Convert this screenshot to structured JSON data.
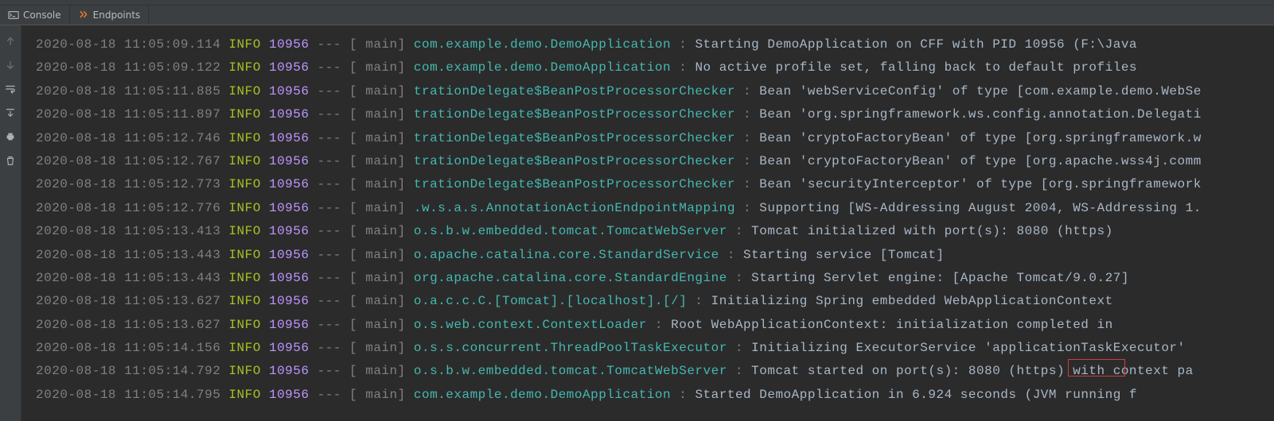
{
  "tabs": {
    "console": "Console",
    "endpoints": "Endpoints"
  },
  "log_fixed": {
    "thread_prefix": "",
    "thread": "main",
    "dashes": "---",
    "separator": ":"
  },
  "logs": [
    {
      "ts": "2020-08-18 11:05:09.114",
      "level": "INFO",
      "pid": "10956",
      "cls": "com.example.demo.DemoApplication",
      "msg": "Starting DemoApplication on CFF with PID 10956 (F:\\Java"
    },
    {
      "ts": "2020-08-18 11:05:09.122",
      "level": "INFO",
      "pid": "10956",
      "cls": "com.example.demo.DemoApplication",
      "msg": "No active profile set, falling back to default profiles"
    },
    {
      "ts": "2020-08-18 11:05:11.885",
      "level": "INFO",
      "pid": "10956",
      "cls": "trationDelegate$BeanPostProcessorChecker",
      "msg": "Bean 'webServiceConfig' of type [com.example.demo.WebSe"
    },
    {
      "ts": "2020-08-18 11:05:11.897",
      "level": "INFO",
      "pid": "10956",
      "cls": "trationDelegate$BeanPostProcessorChecker",
      "msg": "Bean 'org.springframework.ws.config.annotation.Delegati"
    },
    {
      "ts": "2020-08-18 11:05:12.746",
      "level": "INFO",
      "pid": "10956",
      "cls": "trationDelegate$BeanPostProcessorChecker",
      "msg": "Bean 'cryptoFactoryBean' of type [org.springframework.w"
    },
    {
      "ts": "2020-08-18 11:05:12.767",
      "level": "INFO",
      "pid": "10956",
      "cls": "trationDelegate$BeanPostProcessorChecker",
      "msg": "Bean 'cryptoFactoryBean' of type [org.apache.wss4j.comm"
    },
    {
      "ts": "2020-08-18 11:05:12.773",
      "level": "INFO",
      "pid": "10956",
      "cls": "trationDelegate$BeanPostProcessorChecker",
      "msg": "Bean 'securityInterceptor' of type [org.springframework"
    },
    {
      "ts": "2020-08-18 11:05:12.776",
      "level": "INFO",
      "pid": "10956",
      "cls": ".w.s.a.s.AnnotationActionEndpointMapping",
      "msg": "Supporting [WS-Addressing August 2004, WS-Addressing 1."
    },
    {
      "ts": "2020-08-18 11:05:13.413",
      "level": "INFO",
      "pid": "10956",
      "cls": "o.s.b.w.embedded.tomcat.TomcatWebServer",
      "msg": "Tomcat initialized with port(s): 8080 (https)"
    },
    {
      "ts": "2020-08-18 11:05:13.443",
      "level": "INFO",
      "pid": "10956",
      "cls": "o.apache.catalina.core.StandardService",
      "msg": "Starting service [Tomcat]"
    },
    {
      "ts": "2020-08-18 11:05:13.443",
      "level": "INFO",
      "pid": "10956",
      "cls": "org.apache.catalina.core.StandardEngine",
      "msg": "Starting Servlet engine: [Apache Tomcat/9.0.27]"
    },
    {
      "ts": "2020-08-18 11:05:13.627",
      "level": "INFO",
      "pid": "10956",
      "cls": "o.a.c.c.C.[Tomcat].[localhost].[/]",
      "msg": "Initializing Spring embedded WebApplicationContext"
    },
    {
      "ts": "2020-08-18 11:05:13.627",
      "level": "INFO",
      "pid": "10956",
      "cls": "o.s.web.context.ContextLoader",
      "msg": "Root WebApplicationContext: initialization completed in"
    },
    {
      "ts": "2020-08-18 11:05:14.156",
      "level": "INFO",
      "pid": "10956",
      "cls": "o.s.s.concurrent.ThreadPoolTaskExecutor",
      "msg": "Initializing ExecutorService 'applicationTaskExecutor'"
    },
    {
      "ts": "2020-08-18 11:05:14.792",
      "level": "INFO",
      "pid": "10956",
      "cls": "o.s.b.w.embedded.tomcat.TomcatWebServer",
      "msg": "Tomcat started on port(s): 8080 (https) with context pa"
    },
    {
      "ts": "2020-08-18 11:05:14.795",
      "level": "INFO",
      "pid": "10956",
      "cls": "com.example.demo.DemoApplication",
      "msg": "Started DemoApplication in 6.924 seconds (JVM running f"
    }
  ]
}
